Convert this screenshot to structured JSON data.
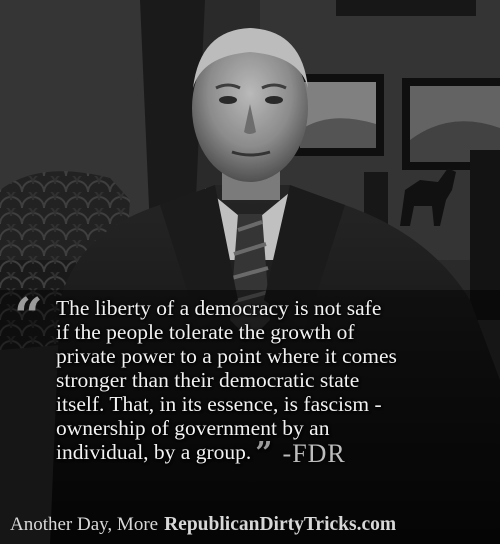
{
  "quote": {
    "open_mark": "“",
    "lines": [
      "The liberty of a democracy is not safe",
      "if the people tolerate the growth of",
      "private power to a point where it comes",
      "stronger than their democratic state",
      "itself. That, in its essence, is fascism -",
      "ownership of government by an",
      "individual, by a group."
    ],
    "close_mark": "”",
    "attribution": "-FDR"
  },
  "footer": {
    "tagline": "Another Day, More",
    "site": "RepublicanDirtyTricks.com"
  }
}
